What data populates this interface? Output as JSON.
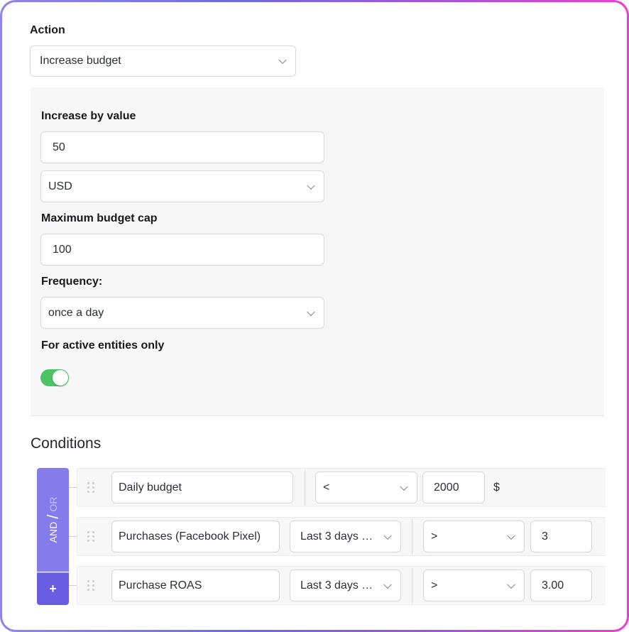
{
  "action": {
    "label": "Action",
    "selected": "Increase budget"
  },
  "settings": {
    "increase_by_label": "Increase by value",
    "increase_by_value": "50",
    "currency_selected": "USD",
    "max_cap_label": "Maximum budget cap",
    "max_cap_value": "100",
    "frequency_label": "Frequency:",
    "frequency_selected": "once a day",
    "active_only_label": "For active entities only",
    "active_only_enabled": true
  },
  "conditions": {
    "title": "Conditions",
    "logic": {
      "and_label": "AND",
      "separator": "/",
      "or_label": "OR",
      "active": "AND"
    },
    "add_label": "+",
    "rows": [
      {
        "metric": "Daily budget",
        "period": null,
        "operator": "<",
        "value": "2000",
        "unit": "$"
      },
      {
        "metric": "Purchases (Facebook Pixel)",
        "period": "Last 3 days …",
        "operator": ">",
        "value": "3",
        "unit": null
      },
      {
        "metric": "Purchase ROAS",
        "period": "Last 3 days …",
        "operator": ">",
        "value": "3.00",
        "unit": null
      }
    ]
  },
  "colors": {
    "toggle_on": "#4cc466",
    "logic_primary": "#857cec",
    "logic_add": "#6a5ce0",
    "frame_gradient_start": "#8d86ea",
    "frame_gradient_end": "#ea3fd0"
  }
}
